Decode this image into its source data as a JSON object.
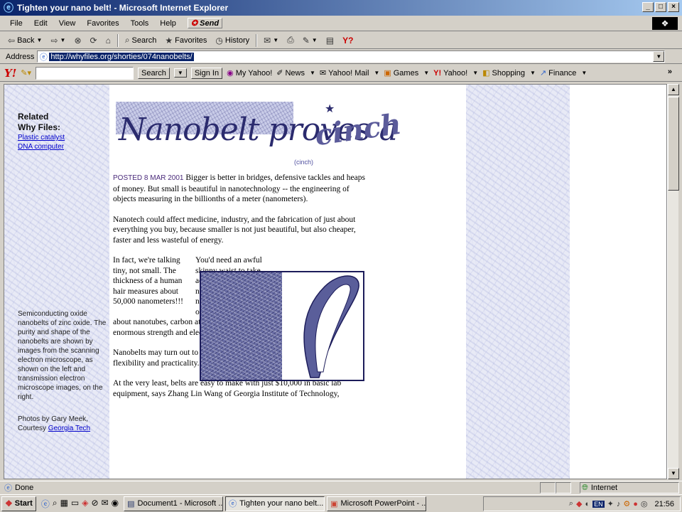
{
  "window": {
    "title": "Tighten your nano belt! - Microsoft Internet Explorer",
    "min": "_",
    "max": "□",
    "close": "×"
  },
  "menu": {
    "items": [
      "File",
      "Edit",
      "View",
      "Favorites",
      "Tools",
      "Help"
    ],
    "send": "Send"
  },
  "toolbar": {
    "back": "Back",
    "search": "Search",
    "favorites": "Favorites",
    "history": "History"
  },
  "address": {
    "label": "Address",
    "url": "http://whyfiles.org/shorties/074nanobelts/"
  },
  "yahoo": {
    "search_button": "Search",
    "sign_in": "Sign In",
    "items": [
      "My Yahoo!",
      "News",
      "Yahoo! Mail",
      "Games",
      "Yahoo!",
      "Shopping",
      "Finance"
    ],
    "more": "»"
  },
  "sidebar": {
    "heading_line1": "Related",
    "heading_line2": "Why Files:",
    "links": [
      "Plastic catalyst",
      "DNA computer"
    ],
    "caption": "Semiconducting oxide nanobelts of zinc oxide. The purity and shape of the nanobelts are shown by images from the scanning electron microscope, as shown on the left and transmission electron microscope images, on the right.",
    "credit_prefix": "Photos by Gary Meek, Courtesy ",
    "credit_link": "Georgia Tech"
  },
  "banner": {
    "title": "Nanobelt proves a",
    "cinch": "cinch",
    "subtitle": "(cinch)"
  },
  "article": {
    "posted": "POSTED 8 MAR 2001",
    "p1": " Bigger is better in bridges, defensive tackles and heaps of money. But small is beautiful in nanotechnology -- the engineering of objects measuring in the billionths of a meter (nanometers).",
    "p2": "Nanotech could affect medicine, industry, and the fabrication of just about everything you buy, because smaller is not just beautiful, but also cheaper, faster and less wasteful of energy.",
    "p3": "In fact, we're talking tiny, not small. The thickness of a human hair measures about 50,000 nanometers!!!",
    "p4a": "You'd need an awful skinny waist to take advantage of the latest nanotech fashion -- nanobelts. If you're a fan o' nano, you know",
    "p4b": "about nanotubes, carbon atoms bonded into honeycomb-like shapes with enormous strength and electrical conductivity.",
    "p5": "Nanobelts may turn out to have advantages over tubes in terms of price, flexibility and practicality.",
    "p6": "At the very least, belts are easy to make with just $10,000 in basic lab equipment, says Zhang Lin Wang of Georgia Institute of Technology,"
  },
  "status": {
    "text": "Done",
    "zone": "Internet"
  },
  "taskbar": {
    "start": "Start",
    "tasks": [
      "Document1 - Microsoft ...",
      "Tighten your nano belt...",
      "Microsoft PowerPoint - ..."
    ],
    "clock": "21:56",
    "lang": "EN"
  }
}
